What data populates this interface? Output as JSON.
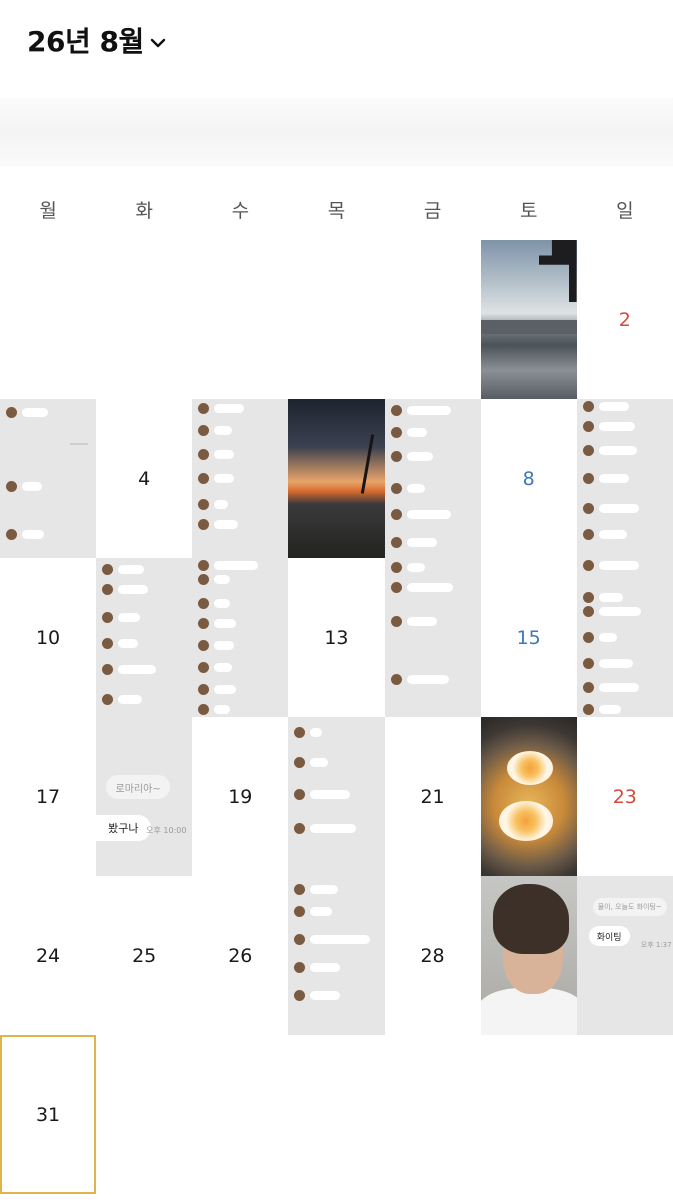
{
  "header": {
    "month_title": "26년 8월",
    "dropdown_icon": "chevron-down-icon"
  },
  "weekdays": [
    "월",
    "화",
    "수",
    "목",
    "금",
    "토",
    "일"
  ],
  "colors": {
    "sunday": "#d64a3c",
    "saturday": "#3f78b8",
    "today_border": "#e0b44a"
  },
  "days": [
    {
      "day": "2",
      "kind": "sunday"
    },
    {
      "day": "4"
    },
    {
      "day": "8",
      "kind": "saturday"
    },
    {
      "day": "10"
    },
    {
      "day": "13"
    },
    {
      "day": "15",
      "kind": "saturday"
    },
    {
      "day": "17"
    },
    {
      "day": "19"
    },
    {
      "day": "21"
    },
    {
      "day": "23",
      "kind": "sunday"
    },
    {
      "day": "24"
    },
    {
      "day": "25"
    },
    {
      "day": "26"
    },
    {
      "day": "28"
    },
    {
      "day": "31",
      "today": true
    }
  ],
  "chat_18": {
    "grey_bubble": "로마리아~",
    "reply": "봤구나",
    "time": "오후 10:00"
  },
  "chat_30": {
    "grey_bubble": "물이, 오늘도 화이팅~",
    "reply": "화이팅",
    "time": "오후 1:37"
  }
}
